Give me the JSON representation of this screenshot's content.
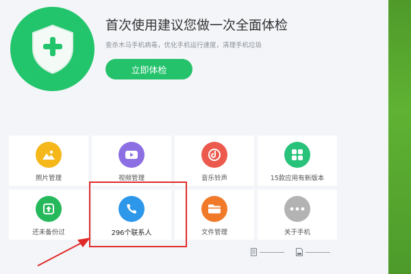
{
  "hero": {
    "title": "首次使用建议您做一次全面体检",
    "subtitle": "查杀木马手机病毒，优化手机运行速度，清理手机垃圾",
    "button": "立即体检"
  },
  "tiles": [
    {
      "label": "照片管理",
      "icon": "photo-icon",
      "color": "#f5b71a"
    },
    {
      "label": "视频管理",
      "icon": "video-icon",
      "color": "#8c6fe3"
    },
    {
      "label": "音乐铃声",
      "icon": "music-icon",
      "color": "#ec5a4d"
    },
    {
      "label": "15款应用有新版本",
      "icon": "apps-icon",
      "color": "#29c27a"
    },
    {
      "label": "还未备份过",
      "icon": "backup-icon",
      "color": "#25b95b"
    },
    {
      "label": "296个联系人",
      "icon": "phone-icon",
      "color": "#2d97ea"
    },
    {
      "label": "文件管理",
      "icon": "folder-icon",
      "color": "#f07a2a"
    },
    {
      "label": "关于手机",
      "icon": "more-icon",
      "color": "#b3b3b3"
    }
  ],
  "colors": {
    "accent": "#24c26b",
    "highlight": "#e02828"
  }
}
